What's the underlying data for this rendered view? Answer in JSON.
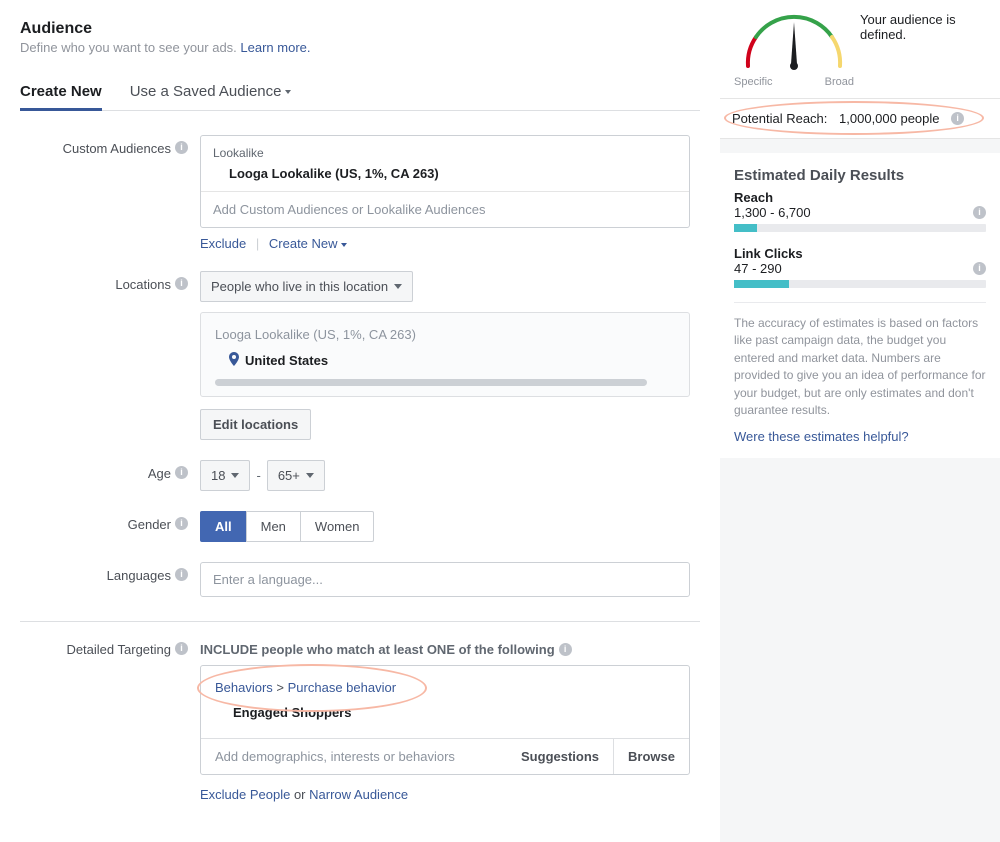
{
  "header": {
    "title": "Audience",
    "subtitle_prefix": "Define who you want to see your ads. ",
    "learn_more": "Learn more."
  },
  "tabs": {
    "create_new": "Create New",
    "saved": "Use a Saved Audience"
  },
  "custom_audiences": {
    "label": "Custom Audiences",
    "group_label": "Lookalike",
    "item": "Looga Lookalike (US, 1%, CA 263)",
    "placeholder": "Add Custom Audiences or Lookalike Audiences",
    "exclude": "Exclude",
    "create_new": "Create New"
  },
  "locations": {
    "label": "Locations",
    "dropdown": "People who live in this location",
    "group_title": "Looga Lookalike (US, 1%, CA 263)",
    "country": "United States",
    "edit_btn": "Edit locations"
  },
  "age": {
    "label": "Age",
    "min": "18",
    "max": "65+"
  },
  "gender": {
    "label": "Gender",
    "all": "All",
    "men": "Men",
    "women": "Women"
  },
  "languages": {
    "label": "Languages",
    "placeholder": "Enter a language..."
  },
  "detailed": {
    "label": "Detailed Targeting",
    "include_title": "INCLUDE people who match at least ONE of the following",
    "breadcrumb_a": "Behaviors",
    "breadcrumb_sep": " > ",
    "breadcrumb_b": "Purchase behavior",
    "item": "Engaged Shoppers",
    "placeholder": "Add demographics, interests or behaviors",
    "suggestions": "Suggestions",
    "browse": "Browse",
    "exclude": "Exclude People",
    "or": " or ",
    "narrow": "Narrow Audience"
  },
  "side": {
    "specific": "Specific",
    "broad": "Broad",
    "defined": "Your audience is defined.",
    "reach_label": "Potential Reach:",
    "reach_value": "1,000,000 people",
    "edr_title": "Estimated Daily Results",
    "reach_metric_label": "Reach",
    "reach_metric_value": "1,300 - 6,700",
    "clicks_label": "Link Clicks",
    "clicks_value": "47 - 290",
    "note": "The accuracy of estimates is based on factors like past campaign data, the budget you entered and market data. Numbers are provided to give you an idea of performance for your budget, but are only estimates and don't guarantee results.",
    "helpful": "Were these estimates helpful?"
  }
}
